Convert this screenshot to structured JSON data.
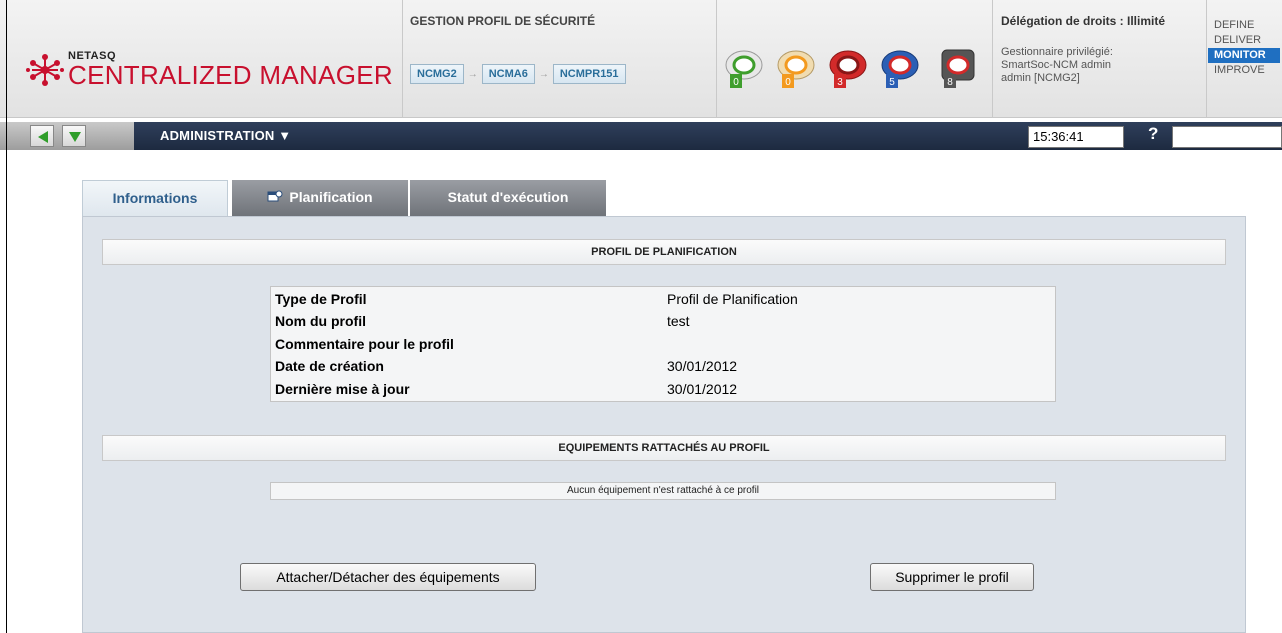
{
  "header": {
    "brand_small": "NETASQ",
    "brand_big": "CENTRALIZED MANAGER",
    "security_profile_title": "GESTION PROFIL DE SÉCURITÉ",
    "breadcrumb": [
      "NCMG2",
      "NCMA6",
      "NCMPR151"
    ],
    "status_icons": [
      {
        "icon": "firewall-status-icon",
        "count": "0",
        "color": "#3f9e2d"
      },
      {
        "icon": "firewall-status-icon",
        "count": "0",
        "color": "#f39a1f"
      },
      {
        "icon": "firewall-status-icon",
        "count": "3",
        "color": "#d22a2a"
      },
      {
        "icon": "firewall-status-icon",
        "count": "5",
        "color": "#2b5fb5"
      },
      {
        "icon": "firewall-status-icon",
        "count": "8",
        "color": "#555555"
      }
    ],
    "delegation_title": "Délégation de droits : Illimité",
    "delegation_line1": "Gestionnaire privilégié:",
    "delegation_line2": "SmartSoc-NCM admin",
    "delegation_line3": "admin [NCMG2]",
    "menu": [
      "DEFINE",
      "DELIVER",
      "MONITOR",
      "IMPROVE"
    ],
    "menu_active": "MONITOR"
  },
  "navbar": {
    "title": "ADMINISTRATION ▼",
    "time": "15:36:41",
    "help": "?"
  },
  "tabs": {
    "informations": "Informations",
    "planification": "Planification",
    "statut": "Statut d'exécution"
  },
  "profile": {
    "section_title": "PROFIL DE PLANIFICATION",
    "rows": [
      {
        "label": "Type de Profil",
        "value": "Profil de Planification"
      },
      {
        "label": "Nom du profil",
        "value": "test"
      },
      {
        "label": "Commentaire pour le profil",
        "value": ""
      },
      {
        "label": "Date de création",
        "value": "30/01/2012"
      },
      {
        "label": "Dernière mise à jour",
        "value": "30/01/2012"
      }
    ]
  },
  "equipment": {
    "section_title": "EQUIPEMENTS RATTACHÉS AU PROFIL",
    "empty_text": "Aucun équipement n'est rattaché à ce profil"
  },
  "buttons": {
    "attach": "Attacher/Détacher des équipements",
    "delete": "Supprimer le profil"
  },
  "colors": {
    "brand_red": "#c8102e",
    "navbar": "#1d2a40",
    "menu_active": "#1f6fc1",
    "tab_active_text": "#2f5f8c"
  }
}
